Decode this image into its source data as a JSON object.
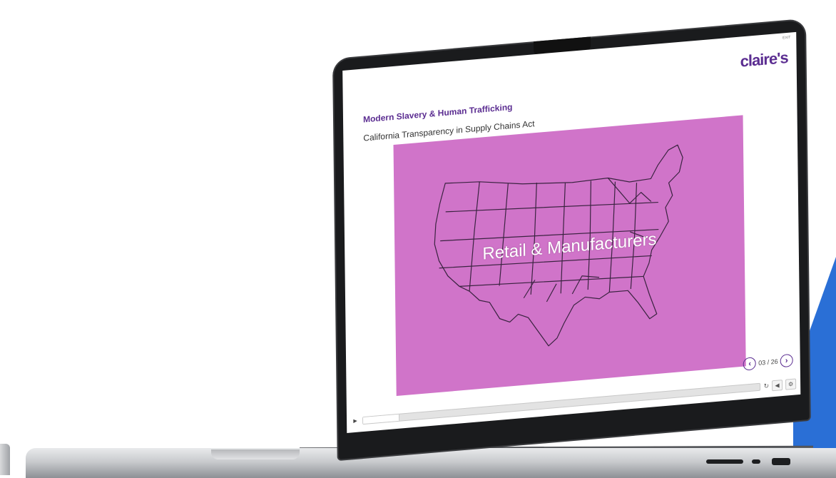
{
  "course": {
    "logo_text": "claire's",
    "exit_label": "EXIT",
    "title": "Modern Slavery & Human Trafficking",
    "slide_title": "California Transparency in Supply Chains Act"
  },
  "slide": {
    "caption": "Retail & Manufacturers",
    "background_color": "#d074c9"
  },
  "navigation": {
    "prev_icon": "chevron-left-circle-icon",
    "next_icon": "chevron-right-circle-icon",
    "prev_glyph": "‹",
    "next_glyph": "›",
    "counter": "03 / 26"
  },
  "player": {
    "play_glyph": "▶",
    "progress": 0.09,
    "replay_glyph": "↻",
    "volume_glyph": "◀",
    "settings_glyph": "⚙"
  },
  "colors": {
    "brand_purple": "#5b2d91",
    "accent_blue": "#2a6fd6"
  }
}
